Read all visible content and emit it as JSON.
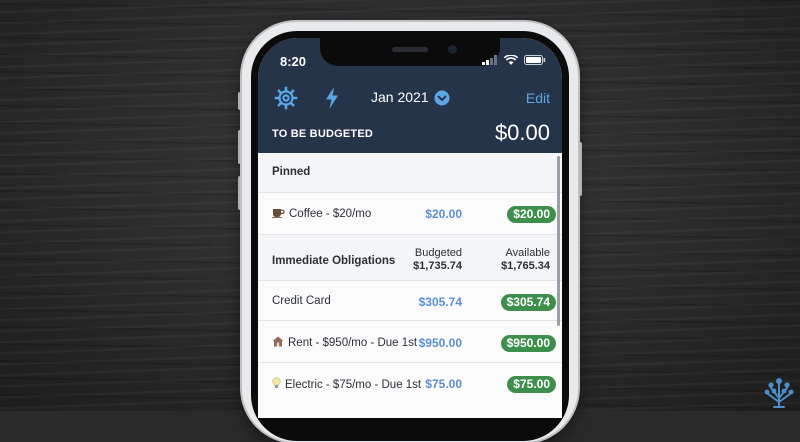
{
  "status_bar": {
    "time": "8:20"
  },
  "nav": {
    "month": "Jan 2021",
    "edit_label": "Edit",
    "gear_icon": "gear-icon",
    "bolt_icon": "lightning-icon"
  },
  "to_be_budgeted": {
    "label": "TO BE BUDGETED",
    "value": "$0.00"
  },
  "pinned": {
    "header": "Pinned",
    "items": [
      {
        "emoji": "coffee-icon",
        "label": "Coffee - $20/mo",
        "budgeted": "$20.00",
        "available": "$20.00"
      }
    ]
  },
  "immediate_obligations": {
    "header": "Immediate Obligations",
    "budgeted_label": "Budgeted",
    "budgeted_total": "$1,735.74",
    "available_label": "Available",
    "available_total": "$1,765.34",
    "items": [
      {
        "emoji": "",
        "label": "Credit Card",
        "budgeted": "$305.74",
        "available": "$305.74"
      },
      {
        "emoji": "house-icon",
        "label": "Rent - $950/mo - Due 1st",
        "budgeted": "$950.00",
        "available": "$950.00"
      },
      {
        "emoji": "lightbulb-icon",
        "label": "Electric - $75/mo - Due 1st",
        "budgeted": "$75.00",
        "available": "$75.00"
      }
    ]
  },
  "colors": {
    "header_bg": "#263449",
    "accent_blue": "#5b8fd1",
    "available_green": "#3e8e4c"
  }
}
